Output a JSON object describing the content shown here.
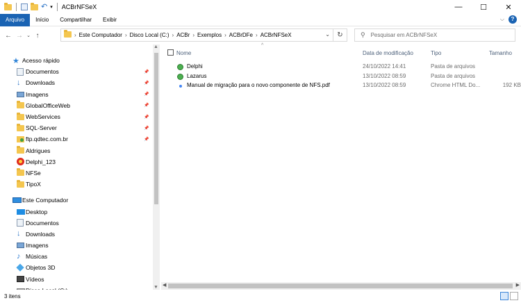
{
  "window": {
    "title": "ACBrNFSeX",
    "controls": {
      "minimize": "—",
      "maximize": "☐",
      "close": "✕"
    }
  },
  "ribbon": {
    "tabs": [
      "Arquivo",
      "Início",
      "Compartilhar",
      "Exibir"
    ],
    "active_tab": "Arquivo",
    "accent_color": "#1a63b3",
    "help": "?"
  },
  "address": {
    "breadcrumbs": [
      "Este Computador",
      "Disco Local (C:)",
      "ACBr",
      "Exemplos",
      "ACBrDFe",
      "ACBrNFSeX"
    ]
  },
  "search": {
    "placeholder": "Pesquisar em ACBrNFSeX"
  },
  "nav": {
    "quick_access": "Acesso rápido",
    "quick_items": [
      {
        "label": "Documentos",
        "icon": "documents-icon",
        "pinned": true
      },
      {
        "label": "Downloads",
        "icon": "download-icon",
        "pinned": true
      },
      {
        "label": "Imagens",
        "icon": "pictures-icon",
        "pinned": true
      },
      {
        "label": "GlobalOfficeWeb",
        "icon": "folder-icon",
        "pinned": true
      },
      {
        "label": "WebServices",
        "icon": "folder-icon",
        "pinned": true
      },
      {
        "label": "SQL-Server",
        "icon": "folder-icon",
        "pinned": true
      },
      {
        "label": "ftp.qdtec.com.br",
        "icon": "ftp-folder-icon",
        "pinned": true
      },
      {
        "label": "Aldrigues",
        "icon": "folder-icon",
        "pinned": false
      },
      {
        "label": "Delphi_123",
        "icon": "delphi-icon",
        "pinned": false
      },
      {
        "label": "NFSe",
        "icon": "folder-icon",
        "pinned": false
      },
      {
        "label": "TipoX",
        "icon": "folder-icon",
        "pinned": false
      }
    ],
    "this_pc": "Este Computador",
    "pc_items": [
      {
        "label": "Desktop",
        "icon": "desktop-icon"
      },
      {
        "label": "Documentos",
        "icon": "documents-icon"
      },
      {
        "label": "Downloads",
        "icon": "download-icon"
      },
      {
        "label": "Imagens",
        "icon": "pictures-icon"
      },
      {
        "label": "Músicas",
        "icon": "music-icon"
      },
      {
        "label": "Objetos 3D",
        "icon": "objects-3d-icon"
      },
      {
        "label": "Vídeos",
        "icon": "videos-icon"
      },
      {
        "label": "Disco Local (C:)",
        "icon": "disk-icon"
      }
    ]
  },
  "columns": {
    "name": "Nome",
    "modified": "Data de modificação",
    "type": "Tipo",
    "size": "Tamanho"
  },
  "files": [
    {
      "name": "Delphi",
      "modified": "24/10/2022 14:41",
      "type": "Pasta de arquivos",
      "size": "",
      "icon": "folder-green-icon"
    },
    {
      "name": "Lazarus",
      "modified": "13/10/2022 08:59",
      "type": "Pasta de arquivos",
      "size": "",
      "icon": "folder-green-icon"
    },
    {
      "name": "Manual de migração para o novo componente de NFS.pdf",
      "modified": "13/10/2022 08:59",
      "type": "Chrome HTML Do...",
      "size": "192 KB",
      "icon": "chrome-icon"
    }
  ],
  "status": {
    "item_count": "3 itens"
  }
}
